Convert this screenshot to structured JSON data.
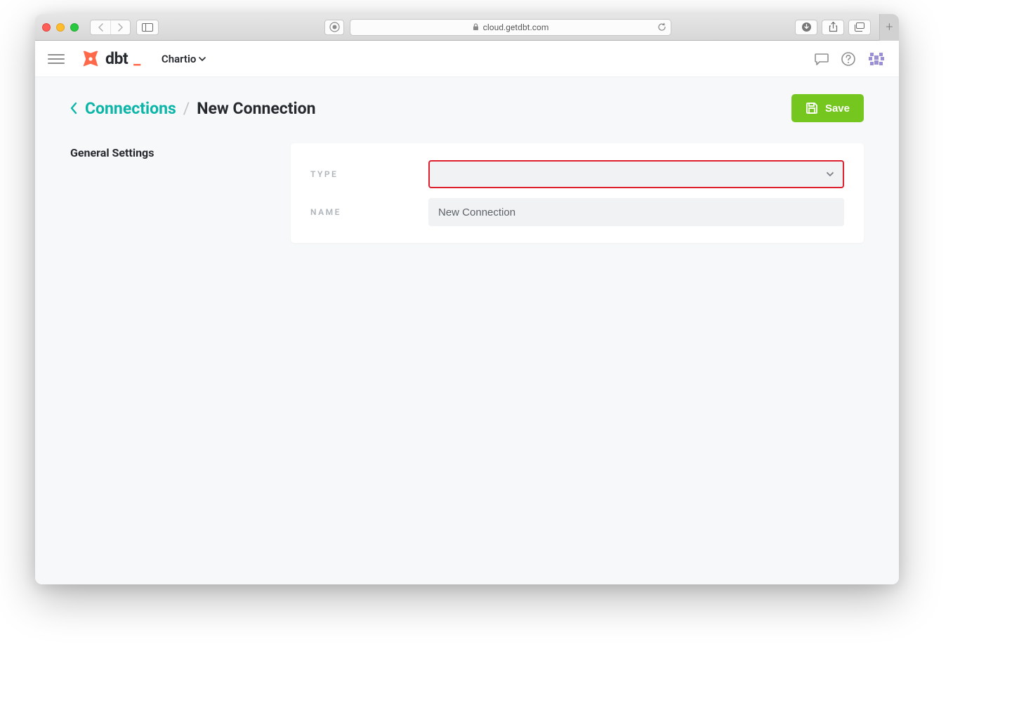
{
  "browser": {
    "url": "cloud.getdbt.com"
  },
  "header": {
    "logo_text": "dbt",
    "org_name": "Chartio"
  },
  "breadcrumb": {
    "parent": "Connections",
    "current": "New Connection",
    "save_label": "Save"
  },
  "form": {
    "section_title": "General Settings",
    "type_label": "TYPE",
    "name_label": "NAME",
    "name_value": "New Connection"
  }
}
